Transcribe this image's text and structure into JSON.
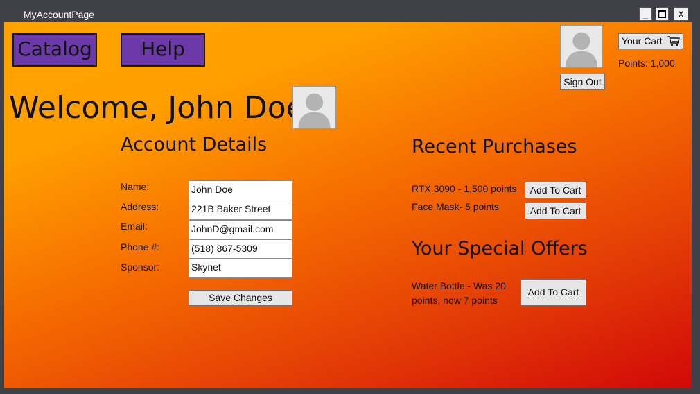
{
  "window": {
    "title": "MyAccountPage",
    "minimize": "_",
    "maximize": "□",
    "close": "X"
  },
  "nav": {
    "catalog": "Catalog",
    "help": "Help"
  },
  "header": {
    "sign_out": "Sign Out",
    "cart_label": "Your Cart",
    "cart_icon": "shopping-cart-icon",
    "points": "Points: 1,000"
  },
  "welcome": "Welcome, John Doe",
  "account": {
    "title": "Account Details",
    "fields": [
      {
        "label": "Name:",
        "value": "John Doe"
      },
      {
        "label": "Address:",
        "value": "221B Baker Street"
      },
      {
        "label": "Email:",
        "value": "JohnD@gmail.com"
      },
      {
        "label": "Phone #:",
        "value": "(518) 867-5309"
      },
      {
        "label": "Sponsor:",
        "value": "Skynet"
      }
    ],
    "save": "Save Changes"
  },
  "purchases": {
    "title": "Recent Purchases",
    "items": [
      {
        "text": "RTX 3090 - 1,500 points",
        "button": "Add To Cart"
      },
      {
        "text": "Face Mask- 5 points",
        "button": "Add To Cart"
      }
    ]
  },
  "offers": {
    "title": "Your Special Offers",
    "items": [
      {
        "line1": "Water Bottle - Was 20",
        "line2": "points, now 7 points",
        "button": "Add To Cart"
      }
    ]
  },
  "colors": {
    "nav_button": "#6b3aa8",
    "gradient_top": "#ffa200",
    "gradient_bottom": "#d10808"
  }
}
